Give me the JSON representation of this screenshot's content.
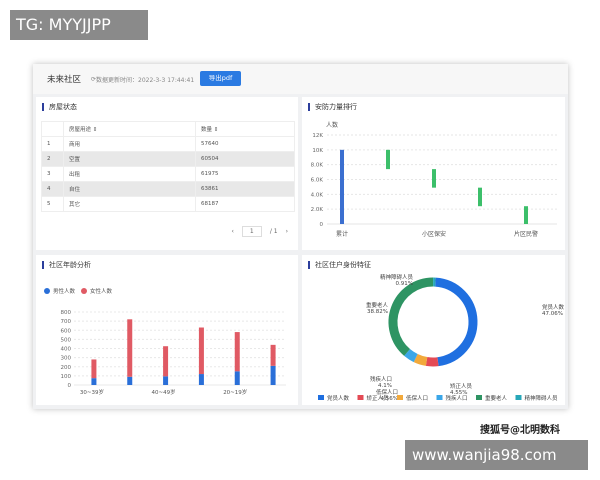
{
  "overlay": {
    "tg": "TG: MYYJJPP",
    "watermark": "搜狐号@北明数科",
    "url": "www.wanjia98.com"
  },
  "header": {
    "title": "未来社区",
    "refresh_icon": "refresh-icon",
    "updated": "数据更新时间：2022-3-3 17:44:41",
    "export_label": "导出pdf"
  },
  "housing": {
    "title": "房屋状态",
    "columns": [
      "",
      "房屋用途",
      "数量"
    ],
    "rows": [
      [
        "1",
        "商用",
        "57640"
      ],
      [
        "2",
        "空置",
        "60504"
      ],
      [
        "3",
        "出租",
        "61975"
      ],
      [
        "4",
        "自住",
        "63861"
      ],
      [
        "5",
        "其它",
        "68187"
      ]
    ],
    "pager": {
      "prev": "‹",
      "page": "1",
      "total": "/ 1",
      "next": "›"
    }
  },
  "security": {
    "title": "安防力量排行",
    "chart_data": {
      "type": "bar",
      "subtype": "waterfall",
      "ylabel": "人数",
      "ylim": [
        0,
        12000
      ],
      "yticks": [
        "0",
        "2.0K",
        "4.0K",
        "6.0K",
        "8.0K",
        "10K",
        "12K"
      ],
      "categories": [
        "累计",
        "",
        "小区保安",
        "",
        "片区民警"
      ],
      "ranges": [
        [
          0,
          10000
        ],
        [
          7400,
          10000
        ],
        [
          4900,
          7400
        ],
        [
          2400,
          4900
        ],
        [
          0,
          2400
        ]
      ],
      "colors": [
        "#3b6fd0",
        "#3cbf6a"
      ],
      "grid": true
    }
  },
  "age": {
    "title": "社区年龄分析",
    "chart_data": {
      "type": "bar",
      "stacked": true,
      "ylim": [
        0,
        800
      ],
      "yticks": [
        "0",
        "100",
        "200",
        "300",
        "400",
        "500",
        "600",
        "700",
        "800"
      ],
      "categories": [
        "30~39岁",
        "",
        "40~49岁",
        "",
        "20~19岁",
        ""
      ],
      "series": [
        {
          "name": "男性人数",
          "color": "#2a6fd8",
          "values": [
            75,
            90,
            95,
            120,
            150,
            210
          ]
        },
        {
          "name": "女性人数",
          "color": "#e05a64",
          "values": [
            205,
            630,
            330,
            510,
            430,
            230
          ]
        }
      ],
      "legend": "top-left",
      "grid": true
    }
  },
  "identity": {
    "title": "社区住户身份特征",
    "chart_data": {
      "type": "pie",
      "donut": true,
      "legend": "bottom",
      "slices": [
        {
          "name": "党员人数",
          "pct": "47.06%",
          "value": 47.06,
          "color": "#1f6fe0"
        },
        {
          "name": "矫正人员",
          "pct": "4.55%",
          "value": 4.55,
          "color": "#e44a55"
        },
        {
          "name": "低保人口",
          "pct": "4.56%",
          "value": 4.56,
          "color": "#f2a93b"
        },
        {
          "name": "残疾人口",
          "pct": "4.1%",
          "value": 4.1,
          "color": "#3aa6e8"
        },
        {
          "name": "重要老人",
          "pct": "38.82%",
          "value": 38.82,
          "color": "#2e9463"
        },
        {
          "name": "精神障碍人员",
          "pct": "0.91%",
          "value": 0.91,
          "color": "#27a7b8"
        }
      ]
    }
  }
}
